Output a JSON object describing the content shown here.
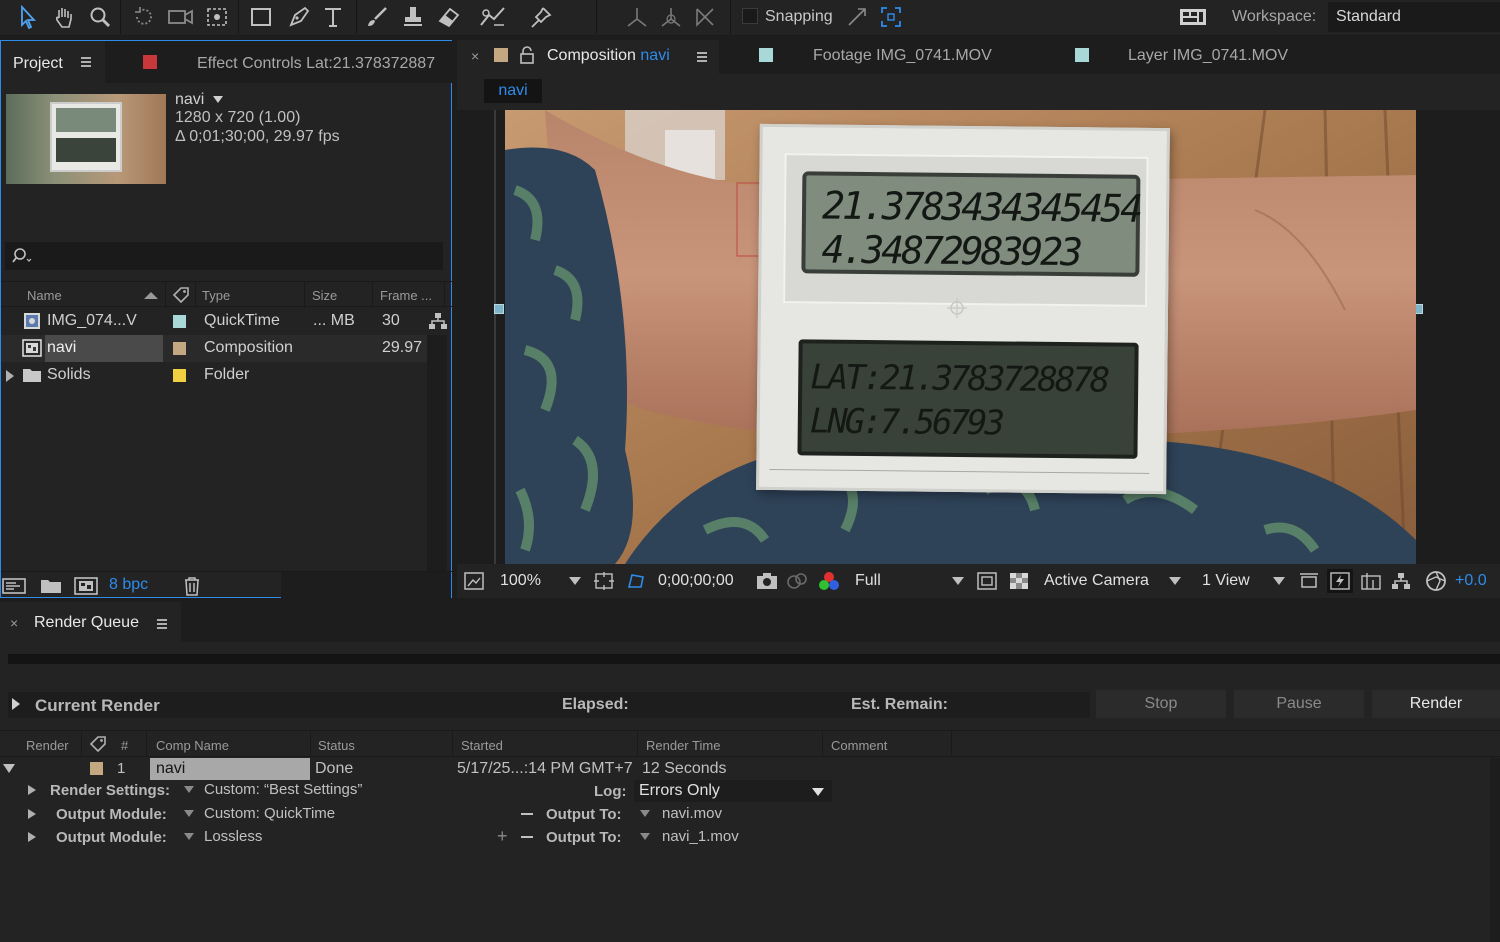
{
  "toolbar": {
    "snapping_label": "Snapping",
    "workspace_label": "Workspace:",
    "workspace_value": "Standard"
  },
  "project_panel": {
    "tab_label": "Project",
    "effect_controls_label": "Effect Controls Lat:21.378372887",
    "preview": {
      "name": "navi",
      "dimensions": "1280 x 720 (1.00)",
      "duration": "Δ 0;01;30;00, 29.97 fps"
    },
    "columns": [
      "Name",
      "Type",
      "Size",
      "Frame ..."
    ],
    "items": [
      {
        "name": "IMG_074...V",
        "type": "QuickTime",
        "size": "... MB",
        "frame": "30",
        "color": "#a8d8d8"
      },
      {
        "name": "navi",
        "type": "Composition",
        "size": "",
        "frame": "29.97",
        "color": "#c4a882"
      },
      {
        "name": "Solids",
        "type": "Folder",
        "size": "",
        "frame": "",
        "color": "#f0d040"
      }
    ],
    "bpc": "8 bpc"
  },
  "composition_panel": {
    "tabs": [
      {
        "prefix": "Composition",
        "name": "navi"
      },
      {
        "prefix": "Footage",
        "name": "IMG_0741.MOV"
      },
      {
        "prefix": "Layer",
        "name": "IMG_0741.MOV"
      }
    ],
    "breadcrumb": "navi",
    "display": {
      "line1": "21.3783434345454",
      "line2": "4.34872983923",
      "line3": "LAT:21.3783728878",
      "line4": "LNG:7.56793"
    },
    "footer": {
      "zoom": "100%",
      "timecode": "0;00;00;00",
      "resolution": "Full",
      "camera": "Active Camera",
      "views": "1 View",
      "exposure": "+0.0"
    }
  },
  "render_queue": {
    "tab_label": "Render Queue",
    "current_render_label": "Current Render",
    "elapsed_label": "Elapsed:",
    "remain_label": "Est. Remain:",
    "buttons": {
      "stop": "Stop",
      "pause": "Pause",
      "render": "Render"
    },
    "columns": [
      "Render",
      "#",
      "Comp Name",
      "Status",
      "Started",
      "Render Time",
      "Comment"
    ],
    "item": {
      "index": "1",
      "comp_name": "navi",
      "status": "Done",
      "started": "5/17/25...:14 PM GMT+7",
      "render_time": "12 Seconds"
    },
    "render_settings_label": "Render Settings:",
    "render_settings_value": "Custom: “Best Settings”",
    "log_label": "Log:",
    "log_value": "Errors Only",
    "output_module_label": "Output Module:",
    "output_modules": [
      {
        "module": "Custom: QuickTime",
        "output_to_label": "Output To:",
        "file": "navi.mov"
      },
      {
        "module": "Lossless",
        "output_to_label": "Output To:",
        "file": "navi_1.mov"
      }
    ]
  }
}
